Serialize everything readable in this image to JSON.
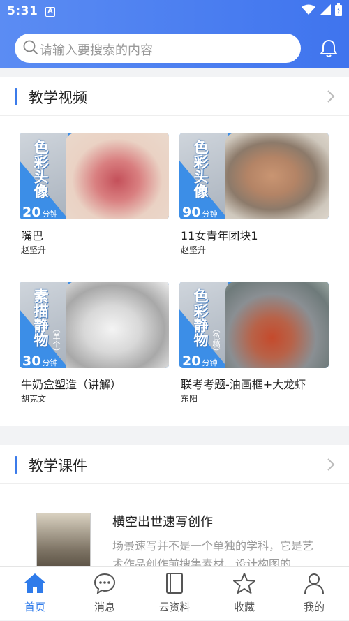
{
  "status_bar": {
    "time": "5:31",
    "a_badge": "A"
  },
  "search": {
    "placeholder": "请输入要搜索的内容"
  },
  "sections": {
    "video": {
      "title": "教学视频",
      "items": [
        {
          "title": "嘴巴",
          "author": "赵坚升",
          "category": "色彩头像",
          "sub": "",
          "minutes": "20",
          "minutes_unit": "分钟"
        },
        {
          "title": "11女青年团块1",
          "author": "赵坚升",
          "category": "色彩头像",
          "sub": "",
          "minutes": "90",
          "minutes_unit": "分钟"
        },
        {
          "title": "牛奶盒塑造（讲解）",
          "author": "胡克文",
          "category": "素描静物",
          "sub": "（单个）",
          "minutes": "30",
          "minutes_unit": "分钟"
        },
        {
          "title": "联考考题-油画框+大龙虾",
          "author": "东阳",
          "category": "色彩静物",
          "sub": "（色稿）",
          "minutes": "20",
          "minutes_unit": "分钟"
        }
      ]
    },
    "course": {
      "title": "教学课件",
      "item": {
        "title": "横空出世速写创作",
        "desc": "场景速写并不是一个单独的学科，它是艺术作品创作前搜集素材、设计构图的"
      }
    }
  },
  "tabbar": [
    {
      "label": "首页",
      "icon": "home-icon",
      "active": true
    },
    {
      "label": "消息",
      "icon": "message-icon",
      "active": false
    },
    {
      "label": "云资料",
      "icon": "book-icon",
      "active": false
    },
    {
      "label": "收藏",
      "icon": "star-icon",
      "active": false
    },
    {
      "label": "我的",
      "icon": "profile-icon",
      "active": false
    }
  ],
  "colors": {
    "accent": "#2f7bea",
    "header": "#4a7ff0"
  }
}
